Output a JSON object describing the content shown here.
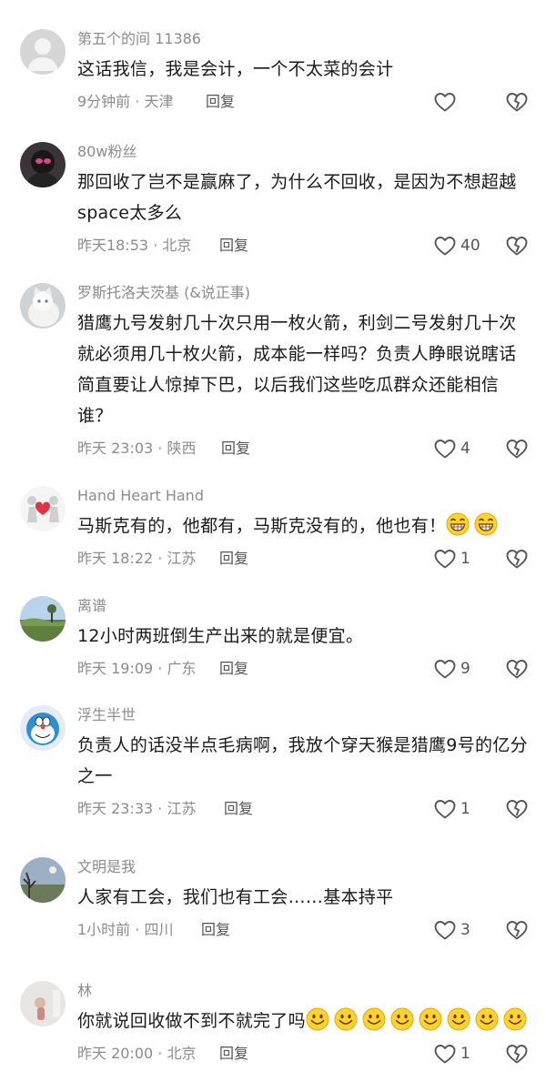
{
  "comments": [
    {
      "username": "第五个的间 11386",
      "avatar_icon": "gray-placeholder-avatar",
      "text": "这话我信，我是会计，一个不太菜的会计",
      "time": "9分钟前 · 天津",
      "reply": "回复",
      "likes": "",
      "dislike_icon": "broken-heart-icon"
    },
    {
      "username": "80w粉丝",
      "avatar_icon": "dark-portrait-avatar",
      "text": "那回收了岂不是赢麻了，为什么不回收，是因为不想超越space太多么",
      "time": "昨天18:53 · 北京",
      "reply": "回复",
      "likes": "40",
      "dislike_icon": "broken-heart-icon"
    },
    {
      "username": "罗斯托洛夫茨基 (&说正事)",
      "avatar_icon": "white-cat-avatar",
      "text": "猎鹰九号发射几十次只用一枚火箭，利剑二号发射几十次就必须用几十枚火箭，成本能一样吗？负责人睁眼说瞎话简直要让人惊掉下巴，以后我们这些吃瓜群众还能相信谁？",
      "time": "昨天 23:03 · 陕西",
      "reply": "回复",
      "likes": "4",
      "dislike_icon": "broken-heart-icon"
    },
    {
      "username": "Hand Heart Hand",
      "avatar_icon": "two-figures-heart-avatar",
      "text": "马斯克有的，他都有，马斯克没有的，他也有！",
      "emojis": 2,
      "emoji_icon": "grin-emoji",
      "time": "昨天 18:22 · 江苏",
      "reply": "回复",
      "likes": "1",
      "dislike_icon": "broken-heart-icon"
    },
    {
      "username": "离谱",
      "avatar_icon": "landscape-avatar",
      "text": "12小时两班倒生产出来的就是便宜。",
      "time": "昨天 19:09 · 广东",
      "reply": "回复",
      "likes": "9",
      "dislike_icon": "broken-heart-icon"
    },
    {
      "username": "浮生半世",
      "avatar_icon": "doraemon-avatar",
      "text": "负责人的话没半点毛病啊，我放个穿天猴是猎鹰9号的亿分之一",
      "time": "昨天 23:33 · 江苏",
      "reply": "回复",
      "likes": "1",
      "dislike_icon": "broken-heart-icon"
    },
    {
      "username": "文明是我",
      "avatar_icon": "tree-sky-avatar",
      "text": "人家有工会，我们也有工会……基本持平",
      "time": "1小时前 · 四川",
      "reply": "回复",
      "likes": "3",
      "dislike_icon": "broken-heart-icon"
    },
    {
      "username": "林",
      "avatar_icon": "light-figure-avatar",
      "text": "你就说回收做不到不就完了吗",
      "emojis": 8,
      "emoji_icon": "smile-emoji",
      "time": "昨天 20:00 · 北京",
      "reply": "回复",
      "likes": "1",
      "dislike_icon": "broken-heart-icon"
    }
  ],
  "colors": {
    "text": "#1a1a1a",
    "meta": "#8c8c8c",
    "icon": "#555555"
  }
}
